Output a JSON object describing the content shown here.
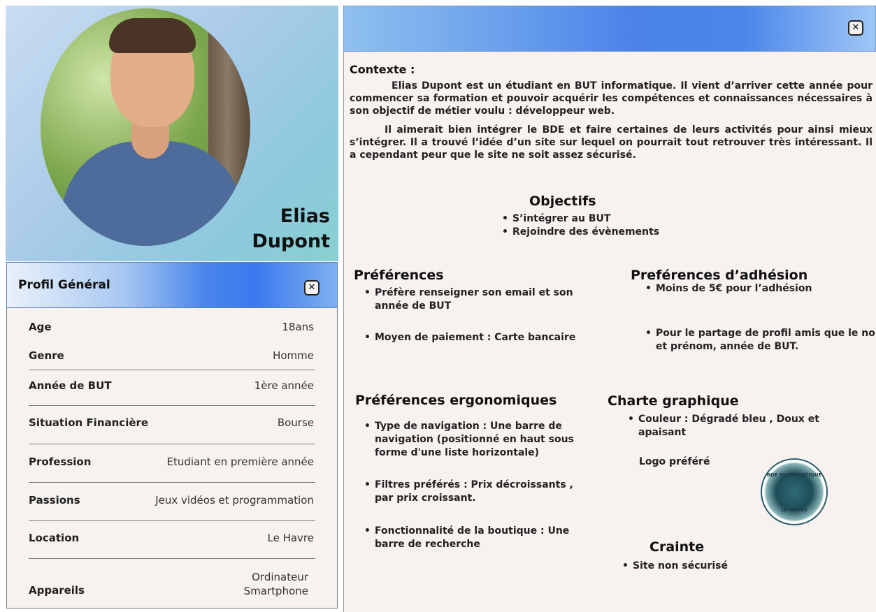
{
  "persona": {
    "name_line1": "Elias",
    "name_line2": "Dupont"
  },
  "profil": {
    "title": "Profil Général",
    "rows": [
      {
        "label": "Age",
        "value": "18ans"
      },
      {
        "label": "Genre",
        "value": "Homme"
      },
      {
        "label": "Année de BUT",
        "value": "1ère année"
      },
      {
        "label": "Situation Financière",
        "value": "Bourse"
      },
      {
        "label": "Profession",
        "value": "Etudiant en première année"
      },
      {
        "label": "Passions",
        "value": "Jeux vidéos et programmation"
      },
      {
        "label": "Location",
        "value": "Le Havre"
      },
      {
        "label": "Appareils",
        "value_line1": "Ordinateur",
        "value_line2": "Smartphone"
      }
    ]
  },
  "close_icon": "✕",
  "contexte": {
    "title": "Contexte :",
    "para1": "Elias Dupont est un étudiant en BUT informatique. Il vient d’arriver cette année pour commencer sa formation et pouvoir acquérir les compétences et connaissances nécessaires à son objectif de métier voulu : développeur web.",
    "para2": "Il aimerait bien intégrer le BDE et faire certaines de leurs activités pour ainsi mieux s’intégrer. Il a trouvé l’idée d’un site sur lequel on pourrait tout retrouver très intéressant.  Il a cependant peur que le site ne soit assez sécurisé."
  },
  "objectifs": {
    "title": "Objectifs",
    "items": [
      "S’intégrer au BUT",
      "Rejoindre des évènements"
    ]
  },
  "preferences": {
    "title": "Préférences",
    "items": [
      "Préfère renseigner son email et son année de BUT",
      "Moyen de paiement : Carte bancaire"
    ]
  },
  "adhesion": {
    "title": "Preférences d’adhésion",
    "items": [
      "Moins de 5€ pour l’adhésion",
      "Pour le partage de profil amis que le nom et prénom, année de BUT."
    ]
  },
  "ergonomiques": {
    "title": "Préférences ergonomiques",
    "items": [
      "Type de navigation :  Une barre de navigation (positionné en haut sous forme d'une liste horizontale)",
      "Filtres préférés : Prix décroissants , par prix croissant.",
      "Fonctionnalité de la boutique :  Une barre de recherche"
    ]
  },
  "charte": {
    "title": "Charte graphique",
    "items": [
      "Couleur : Dégradé bleu , Doux et apaisant"
    ],
    "logo_label": "Logo préféré",
    "logo_top": "BDE INFORMATIQUE",
    "logo_bottom": "LE HAVRE"
  },
  "crainte": {
    "title": "Crainte",
    "items": [
      "Site non sécurisé"
    ]
  }
}
